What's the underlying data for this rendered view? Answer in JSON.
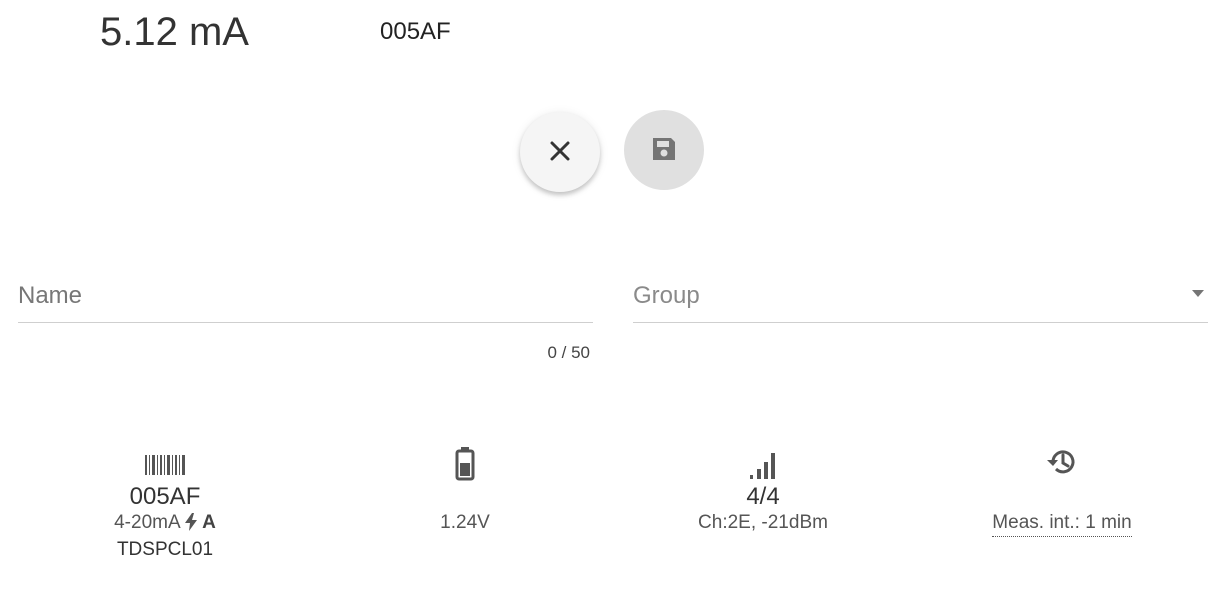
{
  "header": {
    "reading": "5.12 mA",
    "device_id": "005AF"
  },
  "actions": {
    "close_icon": "close-icon",
    "save_icon": "floppy-disk-icon"
  },
  "form": {
    "name_label": "Name",
    "name_value": "",
    "name_counter": "0 / 50",
    "group_label": "Group"
  },
  "info": {
    "device": {
      "icon": "barcode-icon",
      "id": "005AF",
      "type": "4-20mA",
      "type_suffix": "A",
      "model": "TDSPCL01"
    },
    "battery": {
      "icon": "battery-icon",
      "voltage": "1.24V"
    },
    "signal": {
      "icon": "signal-bars-icon",
      "level": "4/4",
      "detail": "Ch:2E, -21dBm"
    },
    "interval": {
      "icon": "history-icon",
      "label": "Meas. int.: 1 min"
    }
  },
  "colors": {
    "icon": "#555555",
    "fab_disabled": "#e0e0e0",
    "fab": "#f5f5f5"
  }
}
